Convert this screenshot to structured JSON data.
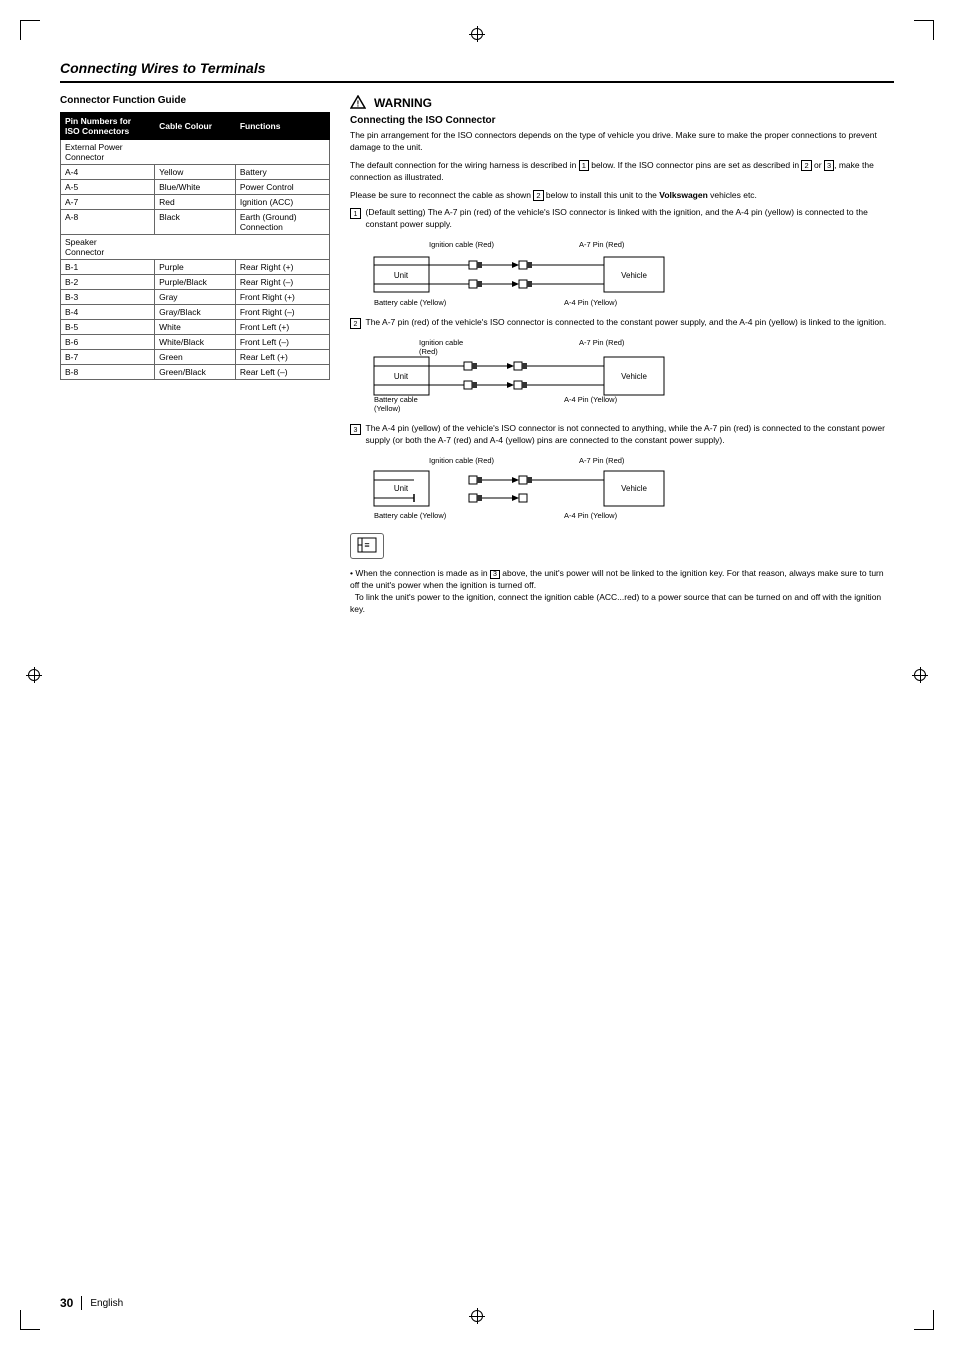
{
  "page": {
    "title": "Connecting Wires to Terminals",
    "number": "30",
    "language": "English"
  },
  "left_section": {
    "title": "Connector Function Guide",
    "table": {
      "headers": [
        "Pin Numbers for ISO Connectors",
        "Cable Colour",
        "Functions"
      ],
      "rows": [
        {
          "category": "External Power Connector",
          "pin": "",
          "color": "",
          "function": ""
        },
        {
          "pin": "A-4",
          "color": "Yellow",
          "function": "Battery"
        },
        {
          "pin": "A-5",
          "color": "Blue/White",
          "function": "Power Control"
        },
        {
          "pin": "A-7",
          "color": "Red",
          "function": "Ignition (ACC)"
        },
        {
          "pin": "A-8",
          "color": "Black",
          "function": "Earth (Ground) Connection"
        },
        {
          "category": "Speaker Connector",
          "pin": "",
          "color": "",
          "function": ""
        },
        {
          "pin": "B-1",
          "color": "Purple",
          "function": "Rear Right (+)"
        },
        {
          "pin": "B-2",
          "color": "Purple/Black",
          "function": "Rear Right (–)"
        },
        {
          "pin": "B-3",
          "color": "Gray",
          "function": "Front Right (+)"
        },
        {
          "pin": "B-4",
          "color": "Gray/Black",
          "function": "Front Right (–)"
        },
        {
          "pin": "B-5",
          "color": "White",
          "function": "Front Left (+)"
        },
        {
          "pin": "B-6",
          "color": "White/Black",
          "function": "Front Left (–)"
        },
        {
          "pin": "B-7",
          "color": "Green",
          "function": "Rear Left (+)"
        },
        {
          "pin": "B-8",
          "color": "Green/Black",
          "function": "Rear Left (–)"
        }
      ]
    }
  },
  "right_section": {
    "warning_label": "WARNING",
    "subsection_title": "Connecting the ISO Connector",
    "paragraphs": [
      "The pin arrangement for the ISO connectors depends on the type of vehicle you drive. Make sure to make the proper connections to prevent damage to the unit.",
      "The default connection for the wiring harness is described in 1 below. If the ISO connector pins are set as described in 2 or 3, make the connection as illustrated.",
      "Please be sure to reconnect the cable as shown 2 below to install this unit to the Volkswagen vehicles etc."
    ],
    "items": [
      {
        "num": "1",
        "text": "(Default setting) The A-7 pin (red) of the vehicle's ISO connector is linked with the ignition, and the A-4 pin (yellow) is connected to the constant power supply.",
        "diagram": {
          "top_left_label": "Ignition cable (Red)",
          "top_right_label": "A-7 Pin (Red)",
          "left_label": "Unit",
          "right_label": "Vehicle",
          "bottom_left_label": "Battery cable (Yellow)",
          "bottom_right_label": "A-4 Pin (Yellow)"
        }
      },
      {
        "num": "2",
        "text": "The A-7 pin (red) of the vehicle's ISO connector is connected to the constant power supply, and the A-4 pin (yellow) is linked to the ignition.",
        "diagram": {
          "top_left_label": "Ignition cable (Red)",
          "top_right_label": "A-7 Pin (Red)",
          "left_label": "Unit",
          "right_label": "Vehicle",
          "bottom_left_label": "Battery cable (Yellow)",
          "bottom_right_label": "A-4 Pin (Yellow)"
        }
      },
      {
        "num": "3",
        "text": "The A-4 pin (yellow) of the vehicle's ISO connector is not connected to anything, while the A-7 pin (red) is connected to the constant power supply (or both the A-7 (red) and A-4 (yellow) pins are connected to the constant power supply).",
        "diagram": {
          "top_left_label": "Ignition cable (Red)",
          "top_right_label": "A-7 Pin (Red)",
          "left_label": "Unit",
          "right_label": "Vehicle",
          "bottom_left_label": "Battery cable (Yellow)",
          "bottom_right_label": "A-4 Pin (Yellow)"
        }
      }
    ],
    "note": {
      "icon": "⊞",
      "bullets": [
        "When the connection is made as in 3 above, the unit's power will not be linked to the ignition key. For that reason, always make sure to turn off the unit's power when the ignition is turned off.",
        "To link the unit's power to the ignition, connect the ignition cable (ACC...red) to a power source that can be turned on and off with the ignition key."
      ]
    }
  }
}
